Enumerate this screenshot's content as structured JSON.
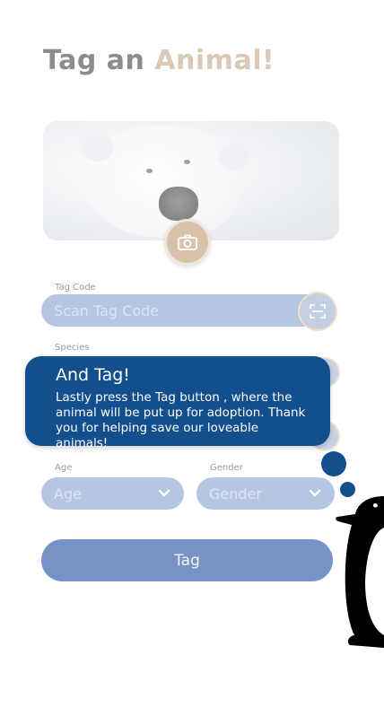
{
  "header": {
    "title_part1": "Tag an",
    "title_part2": "Animal!"
  },
  "form": {
    "tag_code": {
      "label": "Tag Code",
      "placeholder": "Scan Tag Code"
    },
    "species": {
      "label": "Species"
    },
    "age": {
      "label": "Age",
      "value": "Age"
    },
    "gender": {
      "label": "Gender",
      "value": "Gender"
    },
    "submit_label": "Tag"
  },
  "tooltip": {
    "title": "And Tag!",
    "body": "Lastly press the Tag button , where the animal will be put up for adoption. Thank you for helping save our loveable animals!"
  },
  "colors": {
    "accent": "#d8c9b8",
    "primary": "#134f8c",
    "button": "#7792c4",
    "input": "#b5c6e2"
  },
  "icons": [
    "camera-icon",
    "scan-icon",
    "chevron-down-icon",
    "penguin-mascot"
  ]
}
